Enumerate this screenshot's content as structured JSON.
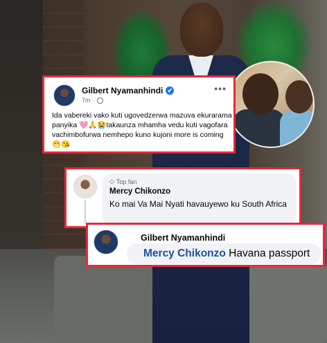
{
  "post": {
    "author": "Gilbert Nyamanhindi",
    "time": "7m",
    "meta_sep": "·",
    "more": "•••",
    "verified_glyph": "✔",
    "text": "Ida vabereki vako kuti ugovedzerwa mazuva ekurarama panyika 🩷🙏😭takaunza mhamha vedu kuti vagofara vachimbofurwa nemhepo kuno kujoni more is coming 😁😘"
  },
  "comment": {
    "badge_icon": "diamond-icon",
    "badge": "Top fan",
    "author": "Mercy Chikonzo",
    "text": "Ko mai Va Mai Nyati havauyewo ku South Africa"
  },
  "reply": {
    "author": "Gilbert Nyamanhindi",
    "mention": "Mercy Chikonzo",
    "text": "Havana passport"
  },
  "colors": {
    "highlight_border": "#e32a3a",
    "verified": "#1877f2",
    "mention": "#1d4f9c",
    "bubble": "#f0f2f5"
  }
}
